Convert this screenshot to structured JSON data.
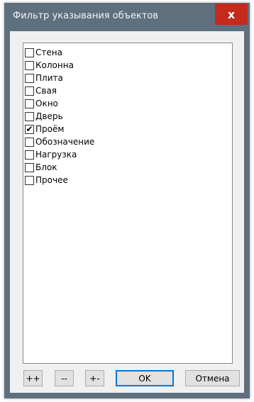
{
  "window": {
    "title": "Фильтр указывания объектов",
    "close_label": "x",
    "title_bar_color": "#5e6f7d",
    "close_color": "#c42b1c"
  },
  "list": {
    "items": [
      {
        "label": "Стена",
        "checked": false
      },
      {
        "label": "Колонна",
        "checked": false
      },
      {
        "label": "Плита",
        "checked": false
      },
      {
        "label": "Свая",
        "checked": false
      },
      {
        "label": "Окно",
        "checked": false
      },
      {
        "label": "Дверь",
        "checked": false
      },
      {
        "label": "Проём",
        "checked": true
      },
      {
        "label": "Обозначение",
        "checked": false
      },
      {
        "label": "Нагрузка",
        "checked": false
      },
      {
        "label": "Блок",
        "checked": false
      },
      {
        "label": "Прочее",
        "checked": false
      }
    ]
  },
  "buttons": {
    "select_all": "++",
    "deselect_all": "--",
    "invert": "+-",
    "ok": "OK",
    "cancel": "Отмена"
  }
}
